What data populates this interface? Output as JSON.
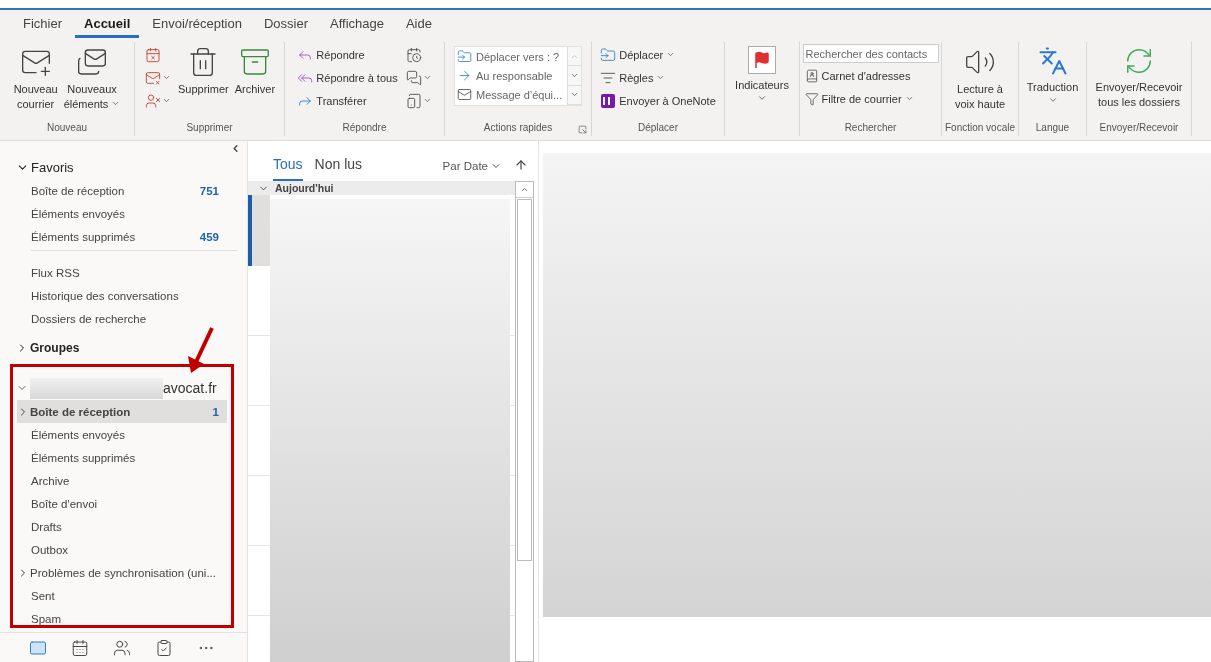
{
  "ribbon": {
    "tabs": [
      {
        "label": "Fichier",
        "selected": false
      },
      {
        "label": "Accueil",
        "selected": true
      },
      {
        "label": "Envoi/réception",
        "selected": false
      },
      {
        "label": "Dossier",
        "selected": false
      },
      {
        "label": "Affichage",
        "selected": false
      },
      {
        "label": "Aide",
        "selected": false
      }
    ],
    "groups": [
      {
        "label": "Nouveau",
        "columns": [
          [
            {
              "kind": "large",
              "lines": [
                "Nouveau",
                "courrier"
              ],
              "menu": false
            }
          ],
          [
            {
              "kind": "large",
              "lines": [
                "Nouveaux",
                "éléments"
              ],
              "menu": true
            }
          ]
        ]
      },
      {
        "label": "Supprimer",
        "columns": [
          [
            {
              "kind": "icon",
              "menu": false
            },
            {
              "kind": "icon",
              "menu": true
            },
            {
              "kind": "icon",
              "menu": true
            }
          ],
          [
            {
              "kind": "large",
              "lines": [
                "Supprimer"
              ],
              "menu": false
            }
          ],
          [
            {
              "kind": "large",
              "lines": [
                "Archiver"
              ],
              "menu": false
            }
          ]
        ]
      },
      {
        "label": "Répondre",
        "columns": [
          [
            {
              "kind": "small",
              "label": "Répondre",
              "menu": false
            },
            {
              "kind": "small",
              "label": "Répondre à tous",
              "menu": false
            },
            {
              "kind": "small",
              "label": "Transférer",
              "menu": false
            }
          ],
          [
            {
              "kind": "icon",
              "menu": false
            },
            {
              "kind": "icon",
              "menu": true
            },
            {
              "kind": "icon",
              "menu": true
            }
          ]
        ]
      },
      {
        "label": "Actions rapides",
        "launcher": true,
        "columns": [
          [
            {
              "kind": "gallery",
              "items": [
                "Déplacer vers : ?",
                "Au responsable",
                "Message d’équi..."
              ]
            }
          ]
        ]
      },
      {
        "label": "Déplacer",
        "columns": [
          [
            {
              "kind": "small",
              "label": "Déplacer",
              "menu": true
            },
            {
              "kind": "small",
              "label": "Règles",
              "menu": true
            },
            {
              "kind": "small",
              "label": "Envoyer à OneNote",
              "menu": false
            }
          ]
        ]
      },
      {
        "columns": [
          [
            {
              "kind": "large",
              "lines": [
                "Indicateurs"
              ],
              "menu": true
            }
          ]
        ]
      },
      {
        "label": "Rechercher",
        "columns": [
          [
            {
              "kind": "search",
              "placeholder": "Rechercher des contacts"
            },
            {
              "kind": "small",
              "label": "Carnet d'adresses",
              "menu": false
            },
            {
              "kind": "small",
              "label": "Filtre de courrier",
              "menu": true
            }
          ]
        ]
      },
      {
        "label": "Fonction vocale",
        "columns": [
          [
            {
              "kind": "large",
              "lines": [
                "Lecture à",
                "voix haute"
              ],
              "menu": false
            }
          ]
        ]
      },
      {
        "label": "Langue",
        "columns": [
          [
            {
              "kind": "large",
              "lines": [
                "Traduction"
              ],
              "menu": true
            }
          ]
        ]
      },
      {
        "label": "Envoyer/Recevoir",
        "columns": [
          [
            {
              "kind": "large",
              "lines": [
                "Envoyer/Recevoir",
                "tous les dossiers"
              ],
              "menu": false
            }
          ]
        ]
      }
    ]
  },
  "folder_pane": {
    "favorites": {
      "title": "Favoris",
      "expanded": true,
      "items": [
        {
          "label": "Boîte de réception",
          "count": "751"
        },
        {
          "label": "Éléments envoyés"
        },
        {
          "label": "Éléments supprimés",
          "count": "459"
        }
      ]
    },
    "folders": [
      {
        "label": "Flux RSS"
      },
      {
        "label": "Historique des conversations"
      },
      {
        "label": "Dossiers de recherche"
      }
    ],
    "groups": {
      "title": "Groupes",
      "expanded": false
    },
    "account": {
      "title": "avocat.fr",
      "expanded": true,
      "items": [
        {
          "label": "Boîte de réception",
          "count": "1",
          "selected": true,
          "expandable": true
        },
        {
          "label": "Éléments envoyés",
          "selected": false,
          "expandable": false
        },
        {
          "label": "Éléments supprimés",
          "selected": false,
          "expandable": false
        },
        {
          "label": "Archive",
          "selected": false,
          "expandable": false
        },
        {
          "label": "Boîte d'envoi",
          "selected": false,
          "expandable": false
        },
        {
          "label": "Drafts",
          "selected": false,
          "expandable": false
        },
        {
          "label": "Outbox",
          "selected": false,
          "expandable": false
        },
        {
          "label": "Problèmes de synchronisation (uni...",
          "selected": false,
          "expandable": true
        },
        {
          "label": "Sent",
          "selected": false,
          "expandable": false
        },
        {
          "label": "Spam",
          "selected": false,
          "expandable": false
        }
      ]
    },
    "nav": [
      {
        "selected": true
      },
      {
        "selected": false
      },
      {
        "selected": false
      },
      {
        "selected": false
      },
      {
        "selected": false
      }
    ]
  },
  "message_list": {
    "filters": [
      {
        "label": "Tous",
        "selected": true
      },
      {
        "label": "Non lus",
        "selected": false
      }
    ],
    "sort": "Par Date",
    "group_header": {
      "label": "Aujourd'hui",
      "expanded": true
    }
  }
}
